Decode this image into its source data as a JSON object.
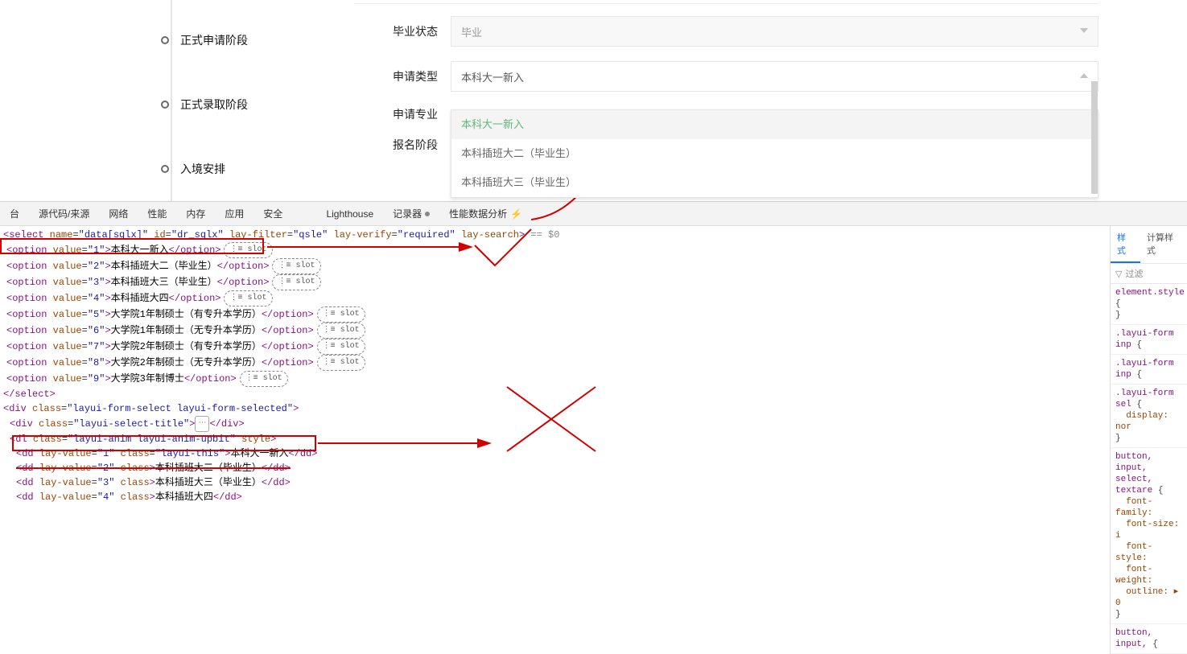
{
  "timeline": {
    "items": [
      {
        "label": "正式申请阶段"
      },
      {
        "label": "正式录取阶段"
      },
      {
        "label": "入境安排"
      }
    ]
  },
  "form": {
    "grad_status": {
      "label": "毕业状态",
      "value": "毕业"
    },
    "app_type": {
      "label": "申请类型",
      "value": "本科大一新入"
    },
    "app_major": {
      "label": "申请专业"
    },
    "signup_stage": {
      "label": "报名阶段"
    }
  },
  "dropdown": {
    "items": [
      "本科大一新入",
      "本科插班大二（毕业生）",
      "本科插班大三（毕业生）"
    ],
    "active_index": 0
  },
  "devtools": {
    "tabs": [
      "台",
      "源代码/来源",
      "网络",
      "性能",
      "内存",
      "应用",
      "安全",
      "Lighthouse",
      "记录器",
      "性能数据分析"
    ],
    "styles_tabs": [
      "样式",
      "计算样式"
    ],
    "filter_label": "过滤"
  },
  "code": {
    "select_tag": "<select name=\"data[sqlx]\" id=\"dr_sqlx\" lay-filter=\"qsle\" lay-verify=\"required\" lay-search>",
    "eq0": "== $0",
    "slot_label": "slot",
    "options": [
      {
        "value": "1",
        "text": "本科大一新入",
        "slot": true,
        "highlight": true
      },
      {
        "value": "2",
        "text": "本科插班大二（毕业生）",
        "slot": true
      },
      {
        "value": "3",
        "text": "本科插班大三（毕业生）",
        "slot": true
      },
      {
        "value": "4",
        "text": "本科插班大四",
        "slot": true
      },
      {
        "value": "5",
        "text": "大学院1年制硕士（有专升本学历）",
        "slot": true
      },
      {
        "value": "6",
        "text": "大学院1年制硕士（无专升本学历）",
        "slot": true
      },
      {
        "value": "7",
        "text": "大学院2年制硕士（有专升本学历）",
        "slot": true
      },
      {
        "value": "8",
        "text": "大学院2年制硕士（无专升本学历）",
        "slot": true
      },
      {
        "value": "9",
        "text": "大学院3年制博士",
        "slot": true
      }
    ],
    "select_close": "</select>",
    "div1": "<div class=\"layui-form-select layui-form-selected\">",
    "div2": "<div class=\"layui-select-title\">…</div>",
    "dl_line": "<dl class=\"layui-anim layui-anim-upbit\" style>",
    "dd_items": [
      {
        "value": "1",
        "class": "layui-this",
        "text": "本科大一新入",
        "highlight": true
      },
      {
        "value": "2",
        "class": " ",
        "text": "本科插班大二（毕业生）",
        "strike": true
      },
      {
        "value": "3",
        "class": " ",
        "text": "本科插班大三（毕业生）"
      },
      {
        "value": "4",
        "class": " ",
        "text": "本科插班大四"
      }
    ]
  },
  "styles": {
    "rules": [
      {
        "selector": "element.style",
        "body": "}"
      },
      {
        "selector": ".layui-form inp",
        "trunc": true
      },
      {
        "selector": ".layui-form inp",
        "trunc": true
      },
      {
        "selector": ".layui-form sel",
        "props": [
          "display: nor"
        ],
        "close": "}"
      },
      {
        "selector": "button, input, select, textare",
        "props": [
          "font-family:",
          "font-size: i",
          "font-style:",
          "font-weight:",
          "outline: ▸ 0"
        ],
        "close": "}"
      },
      {
        "selector": "button, input,",
        "trunc": true
      }
    ]
  },
  "labels": {
    "slot_prefix": "⋮≡ "
  }
}
